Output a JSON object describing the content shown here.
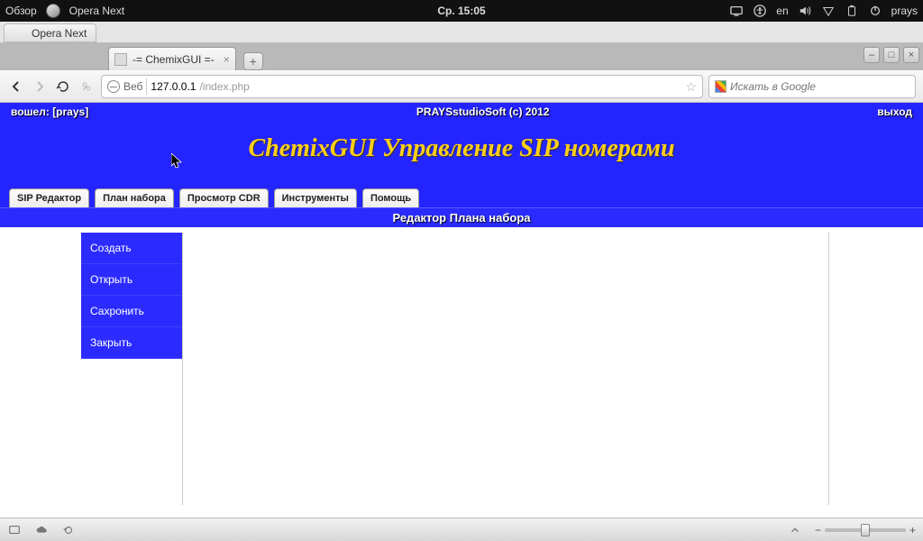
{
  "os_top": {
    "overview": "Обзор",
    "app_name": "Opera Next",
    "clock": "Ср. 15:05",
    "lang": "en",
    "user": "prays"
  },
  "taskbar": {
    "task": "Opera Next"
  },
  "browser": {
    "tab_title": "-= ChemixGUI =-",
    "proto_label": "Веб",
    "url_host": "127.0.0.1",
    "url_path": "/index.php",
    "search_placeholder": "Искать в Google"
  },
  "page": {
    "login_left_prefix": "вошел:",
    "login_left_user": "[prays]",
    "top_center": "PRAYSstudioSoft (c) 2012",
    "logout": "выход",
    "title": "ChemixGUI Управление SIP номерами",
    "tabs": [
      {
        "label": "SIP Редактор"
      },
      {
        "label": "План набора"
      },
      {
        "label": "Просмотр CDR"
      },
      {
        "label": "Инструменты"
      },
      {
        "label": "Помощь"
      }
    ],
    "subheader": "Редактор Плана набора",
    "sidemenu": [
      {
        "label": "Создать"
      },
      {
        "label": "Открыть"
      },
      {
        "label": "Сахронить"
      },
      {
        "label": "Закрыть"
      }
    ]
  }
}
